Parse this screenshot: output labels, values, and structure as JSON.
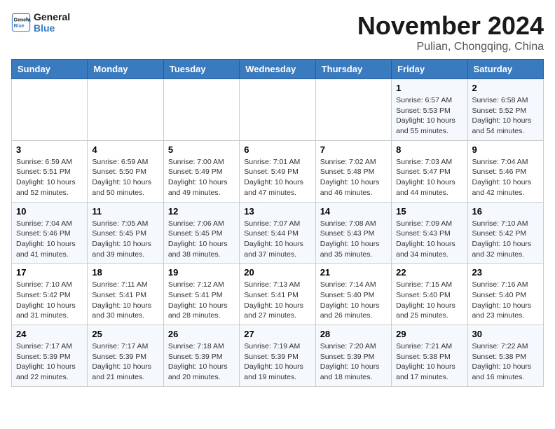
{
  "header": {
    "logo_line1": "General",
    "logo_line2": "Blue",
    "month": "November 2024",
    "location": "Pulian, Chongqing, China"
  },
  "days_of_week": [
    "Sunday",
    "Monday",
    "Tuesday",
    "Wednesday",
    "Thursday",
    "Friday",
    "Saturday"
  ],
  "weeks": [
    [
      {
        "day": "",
        "info": ""
      },
      {
        "day": "",
        "info": ""
      },
      {
        "day": "",
        "info": ""
      },
      {
        "day": "",
        "info": ""
      },
      {
        "day": "",
        "info": ""
      },
      {
        "day": "1",
        "info": "Sunrise: 6:57 AM\nSunset: 5:53 PM\nDaylight: 10 hours and 55 minutes."
      },
      {
        "day": "2",
        "info": "Sunrise: 6:58 AM\nSunset: 5:52 PM\nDaylight: 10 hours and 54 minutes."
      }
    ],
    [
      {
        "day": "3",
        "info": "Sunrise: 6:59 AM\nSunset: 5:51 PM\nDaylight: 10 hours and 52 minutes."
      },
      {
        "day": "4",
        "info": "Sunrise: 6:59 AM\nSunset: 5:50 PM\nDaylight: 10 hours and 50 minutes."
      },
      {
        "day": "5",
        "info": "Sunrise: 7:00 AM\nSunset: 5:49 PM\nDaylight: 10 hours and 49 minutes."
      },
      {
        "day": "6",
        "info": "Sunrise: 7:01 AM\nSunset: 5:49 PM\nDaylight: 10 hours and 47 minutes."
      },
      {
        "day": "7",
        "info": "Sunrise: 7:02 AM\nSunset: 5:48 PM\nDaylight: 10 hours and 46 minutes."
      },
      {
        "day": "8",
        "info": "Sunrise: 7:03 AM\nSunset: 5:47 PM\nDaylight: 10 hours and 44 minutes."
      },
      {
        "day": "9",
        "info": "Sunrise: 7:04 AM\nSunset: 5:46 PM\nDaylight: 10 hours and 42 minutes."
      }
    ],
    [
      {
        "day": "10",
        "info": "Sunrise: 7:04 AM\nSunset: 5:46 PM\nDaylight: 10 hours and 41 minutes."
      },
      {
        "day": "11",
        "info": "Sunrise: 7:05 AM\nSunset: 5:45 PM\nDaylight: 10 hours and 39 minutes."
      },
      {
        "day": "12",
        "info": "Sunrise: 7:06 AM\nSunset: 5:45 PM\nDaylight: 10 hours and 38 minutes."
      },
      {
        "day": "13",
        "info": "Sunrise: 7:07 AM\nSunset: 5:44 PM\nDaylight: 10 hours and 37 minutes."
      },
      {
        "day": "14",
        "info": "Sunrise: 7:08 AM\nSunset: 5:43 PM\nDaylight: 10 hours and 35 minutes."
      },
      {
        "day": "15",
        "info": "Sunrise: 7:09 AM\nSunset: 5:43 PM\nDaylight: 10 hours and 34 minutes."
      },
      {
        "day": "16",
        "info": "Sunrise: 7:10 AM\nSunset: 5:42 PM\nDaylight: 10 hours and 32 minutes."
      }
    ],
    [
      {
        "day": "17",
        "info": "Sunrise: 7:10 AM\nSunset: 5:42 PM\nDaylight: 10 hours and 31 minutes."
      },
      {
        "day": "18",
        "info": "Sunrise: 7:11 AM\nSunset: 5:41 PM\nDaylight: 10 hours and 30 minutes."
      },
      {
        "day": "19",
        "info": "Sunrise: 7:12 AM\nSunset: 5:41 PM\nDaylight: 10 hours and 28 minutes."
      },
      {
        "day": "20",
        "info": "Sunrise: 7:13 AM\nSunset: 5:41 PM\nDaylight: 10 hours and 27 minutes."
      },
      {
        "day": "21",
        "info": "Sunrise: 7:14 AM\nSunset: 5:40 PM\nDaylight: 10 hours and 26 minutes."
      },
      {
        "day": "22",
        "info": "Sunrise: 7:15 AM\nSunset: 5:40 PM\nDaylight: 10 hours and 25 minutes."
      },
      {
        "day": "23",
        "info": "Sunrise: 7:16 AM\nSunset: 5:40 PM\nDaylight: 10 hours and 23 minutes."
      }
    ],
    [
      {
        "day": "24",
        "info": "Sunrise: 7:17 AM\nSunset: 5:39 PM\nDaylight: 10 hours and 22 minutes."
      },
      {
        "day": "25",
        "info": "Sunrise: 7:17 AM\nSunset: 5:39 PM\nDaylight: 10 hours and 21 minutes."
      },
      {
        "day": "26",
        "info": "Sunrise: 7:18 AM\nSunset: 5:39 PM\nDaylight: 10 hours and 20 minutes."
      },
      {
        "day": "27",
        "info": "Sunrise: 7:19 AM\nSunset: 5:39 PM\nDaylight: 10 hours and 19 minutes."
      },
      {
        "day": "28",
        "info": "Sunrise: 7:20 AM\nSunset: 5:39 PM\nDaylight: 10 hours and 18 minutes."
      },
      {
        "day": "29",
        "info": "Sunrise: 7:21 AM\nSunset: 5:38 PM\nDaylight: 10 hours and 17 minutes."
      },
      {
        "day": "30",
        "info": "Sunrise: 7:22 AM\nSunset: 5:38 PM\nDaylight: 10 hours and 16 minutes."
      }
    ]
  ]
}
